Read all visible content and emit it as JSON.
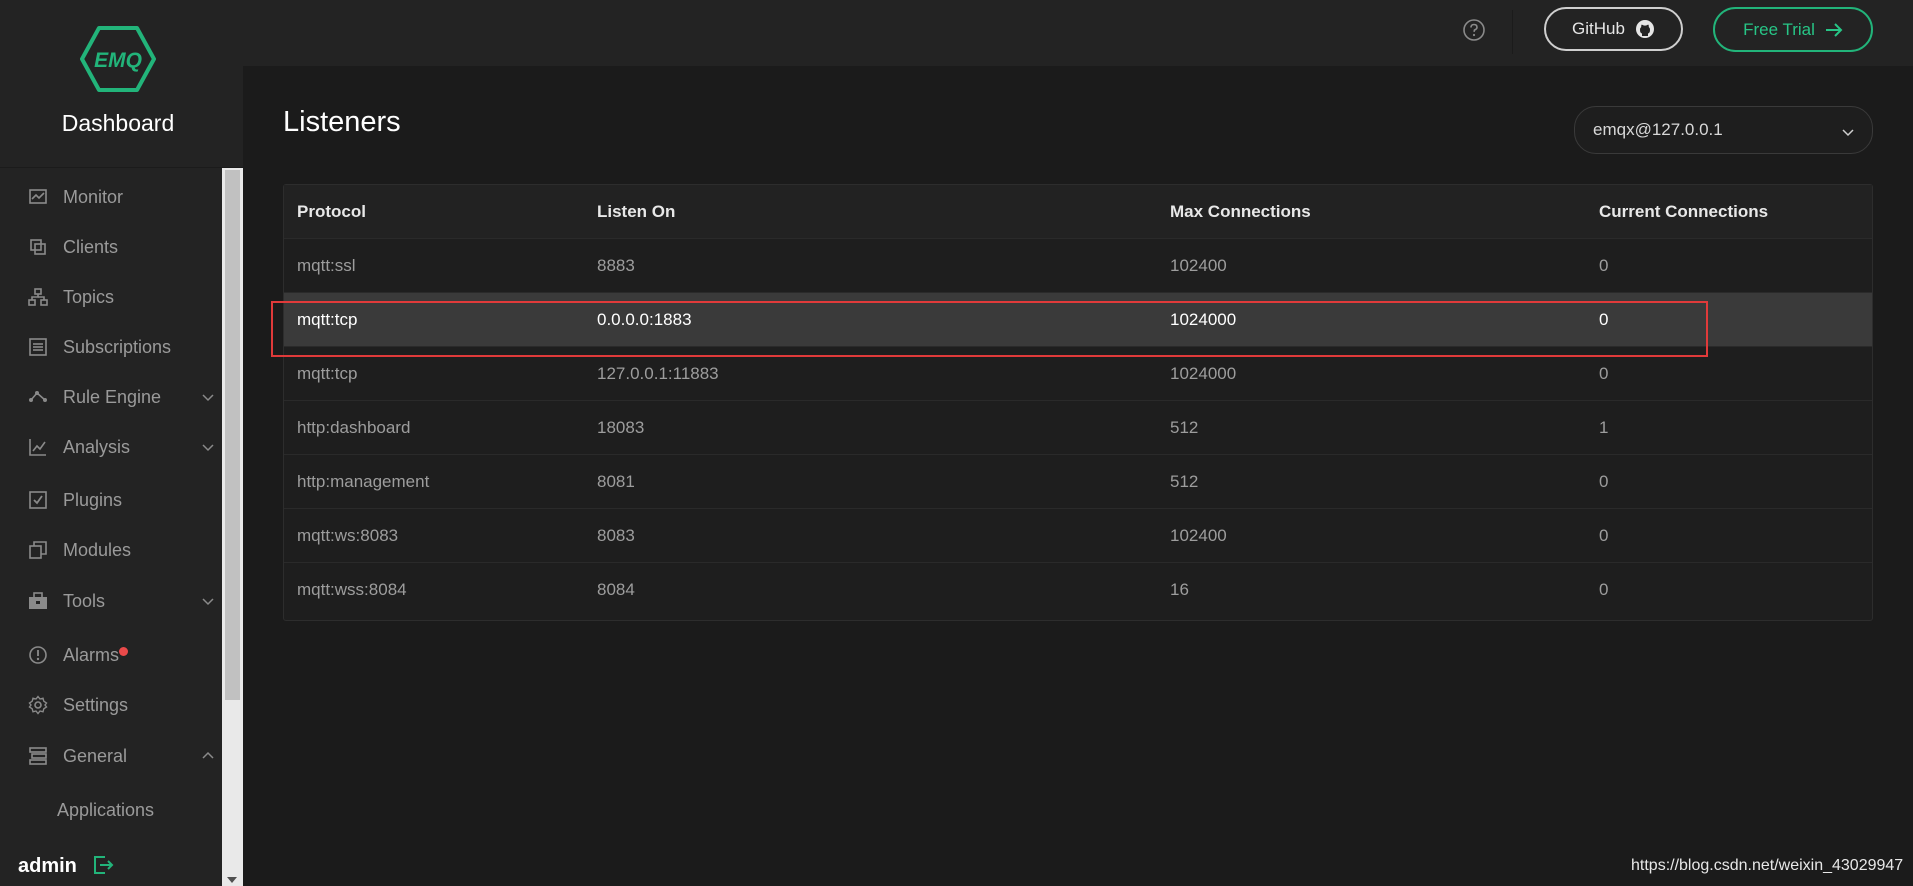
{
  "app": {
    "logo_text": "EMQ",
    "brand_title": "Dashboard"
  },
  "colors": {
    "accent": "#22b47a",
    "alert": "#ea4a4a",
    "annotation": "#e03a3a"
  },
  "sidebar": {
    "items": [
      {
        "label": "Monitor",
        "icon": "monitor-icon"
      },
      {
        "label": "Clients",
        "icon": "clients-icon"
      },
      {
        "label": "Topics",
        "icon": "topics-icon"
      },
      {
        "label": "Subscriptions",
        "icon": "subscriptions-icon"
      },
      {
        "label": "Rule Engine",
        "icon": "rule-engine-icon",
        "expandable": true
      },
      {
        "label": "Analysis",
        "icon": "analysis-icon",
        "expandable": true
      },
      {
        "label": "Plugins",
        "icon": "plugins-icon"
      },
      {
        "label": "Modules",
        "icon": "modules-icon"
      },
      {
        "label": "Tools",
        "icon": "tools-icon",
        "expandable": true
      },
      {
        "label": "Alarms",
        "icon": "alarm-icon",
        "has_alert": true
      },
      {
        "label": "Settings",
        "icon": "gear-icon"
      },
      {
        "label": "General",
        "icon": "general-icon",
        "expanded": true
      },
      {
        "label": "Applications",
        "sub": true
      }
    ],
    "user": "admin"
  },
  "header": {
    "github_label": "GitHub",
    "trial_label": "Free Trial"
  },
  "main": {
    "title": "Listeners",
    "node_select": "emqx@127.0.0.1",
    "table": {
      "headers": [
        "Protocol",
        "Listen On",
        "Max Connections",
        "Current Connections"
      ],
      "rows": [
        [
          "mqtt:ssl",
          "8883",
          "102400",
          "0"
        ],
        [
          "mqtt:tcp",
          "0.0.0.0:1883",
          "1024000",
          "0"
        ],
        [
          "mqtt:tcp",
          "127.0.0.1:11883",
          "1024000",
          "0"
        ],
        [
          "http:dashboard",
          "18083",
          "512",
          "1"
        ],
        [
          "http:management",
          "8081",
          "512",
          "0"
        ],
        [
          "mqtt:ws:8083",
          "8083",
          "102400",
          "0"
        ],
        [
          "mqtt:wss:8084",
          "8084",
          "16",
          "0"
        ]
      ],
      "highlighted_row": 1
    }
  },
  "watermark": "https://blog.csdn.net/weixin_43029947"
}
